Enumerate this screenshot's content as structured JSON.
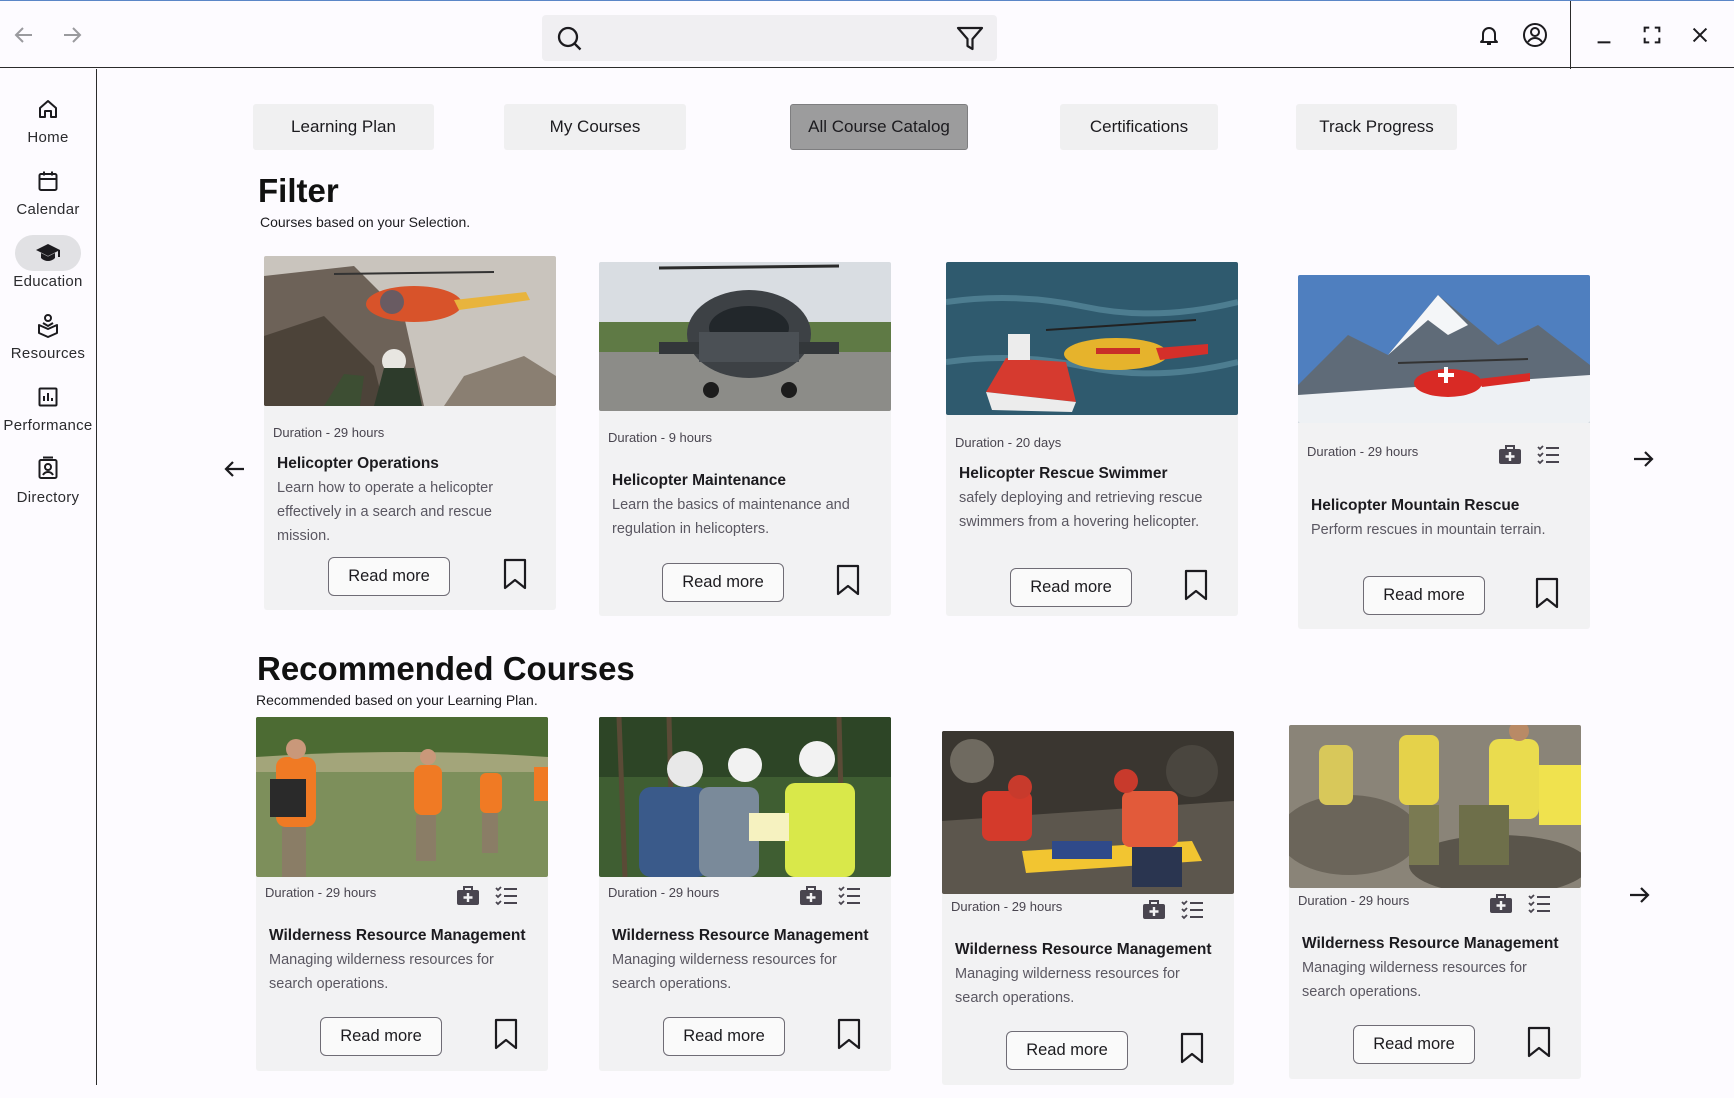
{
  "search": {
    "placeholder": ""
  },
  "tabs": [
    {
      "label": "Learning Plan"
    },
    {
      "label": "My Courses"
    },
    {
      "label": "All Course Catalog"
    },
    {
      "label": "Certifications"
    },
    {
      "label": "Track Progress"
    }
  ],
  "active_tab": "All Course Catalog",
  "sidebar": {
    "items": [
      {
        "label": "Home",
        "icon": "home-icon"
      },
      {
        "label": "Calendar",
        "icon": "calendar-icon"
      },
      {
        "label": "Education",
        "icon": "school-icon"
      },
      {
        "label": "Resources",
        "icon": "resources-icon"
      },
      {
        "label": "Performance",
        "icon": "chart-icon"
      },
      {
        "label": "Directory",
        "icon": "directory-icon"
      }
    ],
    "active": "Education"
  },
  "filter": {
    "title": "Filter",
    "subtitle": "Courses based on your Selection.",
    "cards": [
      {
        "duration": "Duration - 29 hours",
        "title": "Helicopter Operations",
        "description": "Learn how to operate a helicopter effectively in a search and rescue mission.",
        "button": "Read more"
      },
      {
        "duration": "Duration - 9 hours",
        "title": "Helicopter Maintenance",
        "description": "Learn the basics of maintenance and regulation in helicopters.",
        "button": "Read more"
      },
      {
        "duration": "Duration - 20 days",
        "title": "Helicopter Rescue Swimmer",
        "description": "safely deploying and retrieving rescue swimmers from a hovering helicopter.",
        "button": "Read more"
      },
      {
        "duration": "Duration - 29 hours",
        "title": "Helicopter Mountain Rescue",
        "description": "Perform rescues in mountain terrain.",
        "button": "Read more"
      }
    ]
  },
  "recommended": {
    "title": "Recommended Courses",
    "subtitle": "Recommended based on your Learning Plan.",
    "cards": [
      {
        "duration": "Duration - 29 hours",
        "title": "Wilderness Resource Management",
        "description": "Managing wilderness resources for search operations.",
        "button": "Read more"
      },
      {
        "duration": "Duration - 29 hours",
        "title": "Wilderness Resource Management",
        "description": "Managing wilderness resources for search operations.",
        "button": "Read more"
      },
      {
        "duration": "Duration - 29 hours",
        "title": "Wilderness Resource Management",
        "description": "Managing wilderness resources for search operations.",
        "button": "Read more"
      },
      {
        "duration": "Duration - 29 hours",
        "title": "Wilderness Resource Management",
        "description": "Managing wilderness resources for search operations.",
        "button": "Read more"
      }
    ]
  },
  "colors": {
    "background": "#fdfbff",
    "card": "#f2f2f3",
    "active_tab": "#9c9c9d",
    "tab": "#f0f0f1",
    "active_nav_pill": "#e1e1e4"
  }
}
